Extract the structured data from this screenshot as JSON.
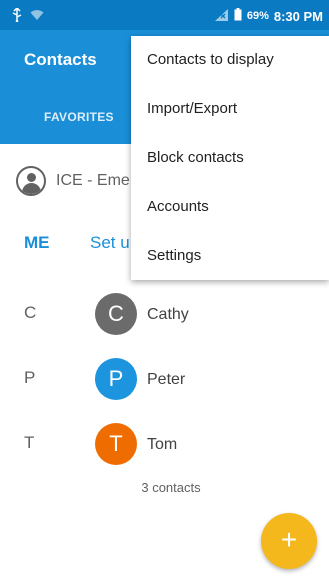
{
  "status_bar": {
    "battery": "69%",
    "time": "8:30 PM",
    "icons": [
      "usb-icon",
      "wifi-icon",
      "no-signal-icon",
      "battery-icon"
    ]
  },
  "app_bar": {
    "title": "Contacts",
    "tabs": [
      {
        "label": "FAVORITES"
      }
    ]
  },
  "ice": {
    "label": "ICE - Eme"
  },
  "me": {
    "label": "ME",
    "setup": "Set u"
  },
  "contacts": [
    {
      "letter": "C",
      "initial": "C",
      "name": "Cathy",
      "color": "#6b6b6b"
    },
    {
      "letter": "P",
      "initial": "P",
      "name": "Peter",
      "color": "#1c95de"
    },
    {
      "letter": "T",
      "initial": "T",
      "name": "Tom",
      "color": "#ef6c00"
    }
  ],
  "contact_count": "3 contacts",
  "fab": {
    "label": "+",
    "color": "#f4b81c"
  },
  "menu": {
    "items": [
      {
        "label": "Contacts to display"
      },
      {
        "label": "Import/Export"
      },
      {
        "label": "Block contacts"
      },
      {
        "label": "Accounts"
      },
      {
        "label": "Settings"
      }
    ]
  },
  "colors": {
    "primary": "#1a8fd8",
    "status": "#0a7bc2"
  }
}
